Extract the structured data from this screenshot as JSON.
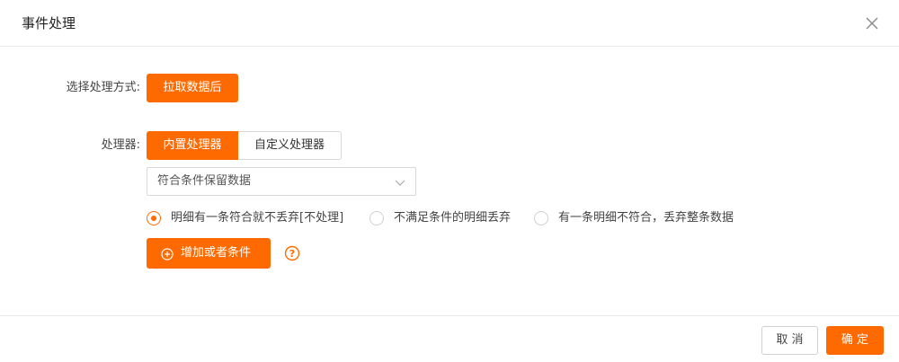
{
  "dialog": {
    "title": "事件处理",
    "close_icon": "close-icon"
  },
  "mode": {
    "label": "选择处理方式:",
    "button_label": "拉取数据后"
  },
  "processor": {
    "label": "处理器:",
    "tabs": [
      {
        "label": "内置处理器",
        "active": true
      },
      {
        "label": "自定义处理器",
        "active": false
      }
    ],
    "select": {
      "value": "符合条件保留数据",
      "arrow_icon": "chevron-down-icon"
    },
    "radios": [
      {
        "label": "明细有一条符合就不丢弃[不处理]",
        "checked": true
      },
      {
        "label": "不满足条件的明细丢弃",
        "checked": false
      },
      {
        "label": "有一条明细不符合，丢弃整条数据",
        "checked": false
      }
    ],
    "add_condition": {
      "label": "增加或者条件",
      "icon": "plus-circle-icon"
    },
    "help_icon": "question-circle-icon"
  },
  "footer": {
    "cancel_label": "取 消",
    "ok_label": "确 定"
  },
  "colors": {
    "accent": "#ff6a00",
    "border": "#d9d9d9",
    "divider": "#e8e8e8"
  }
}
